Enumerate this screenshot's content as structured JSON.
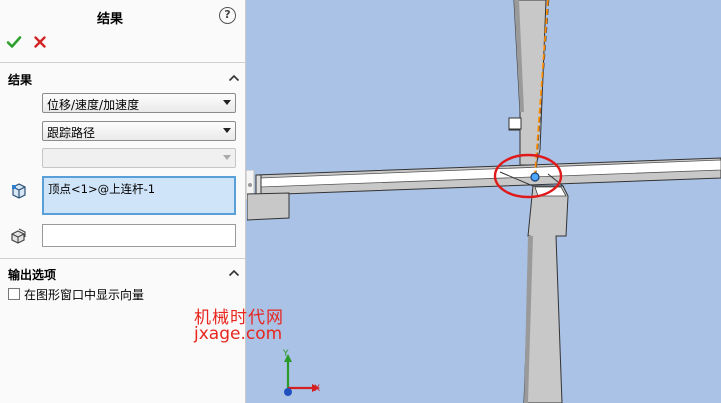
{
  "panel": {
    "title": "结果",
    "help_glyph": "?",
    "ok_icon": "checkmark-icon",
    "cancel_icon": "x-icon"
  },
  "results_section": {
    "title": "结果",
    "result_type_select": "位移/速度/加速度",
    "sub_type_select": "跟踪路径",
    "component_select": "",
    "selected_entity": "顶点<1>@上连杆-1",
    "secondary_selection": ""
  },
  "output_section": {
    "title": "输出选项",
    "show_vector_label": "在图形窗口中显示向量",
    "show_vector_checked": false
  },
  "watermark": {
    "line1": "机械时代网",
    "line2": "jxage.com"
  },
  "triad": {
    "x_label": "X",
    "y_label": "Y"
  },
  "colors": {
    "viewport_background": "#a9c2e6",
    "part_face": "#c8c8c8",
    "part_face_white": "#ffffff",
    "trace_path": "#ff8c00",
    "highlight_circle": "#e01a1a",
    "vertex_point": "#4da6ff",
    "ok_green": "#2ea02e",
    "cancel_red": "#d22424",
    "watermark_red": "#e8261e"
  }
}
